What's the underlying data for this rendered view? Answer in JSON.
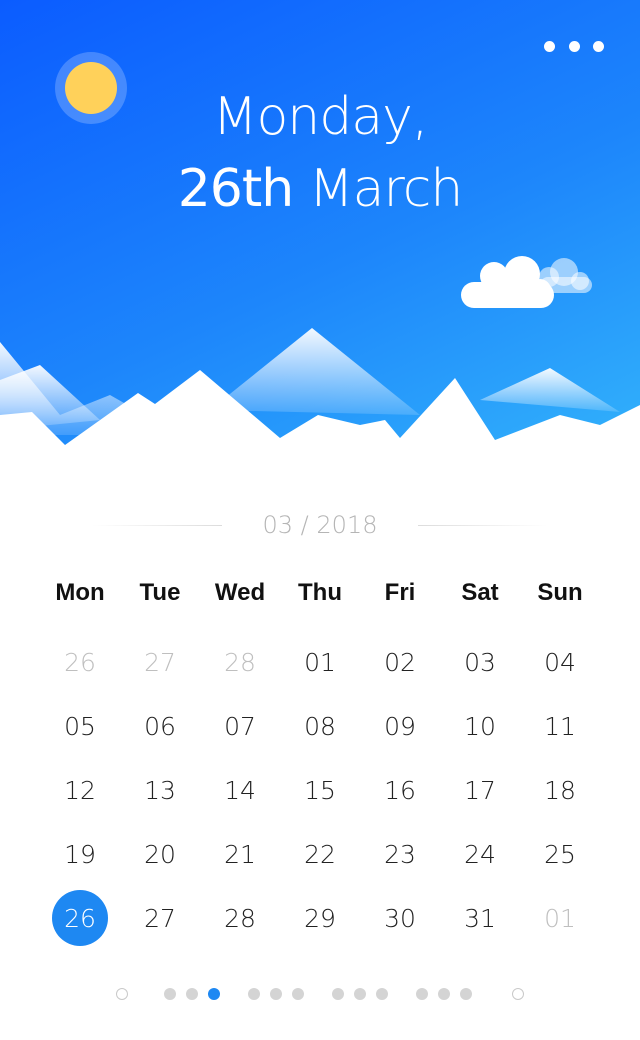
{
  "header": {
    "day_line": "Monday,",
    "date_number": "26th",
    "date_month": "March",
    "menu_icon": "more-dots-icon"
  },
  "calendar": {
    "month_label": "03 / 2018",
    "weekdays": [
      "Mon",
      "Tue",
      "Wed",
      "Thu",
      "Fri",
      "Sat",
      "Sun"
    ],
    "days": [
      {
        "label": "26",
        "muted": true
      },
      {
        "label": "27",
        "muted": true
      },
      {
        "label": "28",
        "muted": true
      },
      {
        "label": "01"
      },
      {
        "label": "02"
      },
      {
        "label": "03"
      },
      {
        "label": "04"
      },
      {
        "label": "05"
      },
      {
        "label": "06"
      },
      {
        "label": "07"
      },
      {
        "label": "08"
      },
      {
        "label": "09"
      },
      {
        "label": "10"
      },
      {
        "label": "11"
      },
      {
        "label": "12"
      },
      {
        "label": "13"
      },
      {
        "label": "14"
      },
      {
        "label": "15"
      },
      {
        "label": "16"
      },
      {
        "label": "17"
      },
      {
        "label": "18"
      },
      {
        "label": "19"
      },
      {
        "label": "20"
      },
      {
        "label": "21"
      },
      {
        "label": "22"
      },
      {
        "label": "23"
      },
      {
        "label": "24"
      },
      {
        "label": "25"
      },
      {
        "label": "26",
        "selected": true
      },
      {
        "label": "27"
      },
      {
        "label": "28"
      },
      {
        "label": "29"
      },
      {
        "label": "30"
      },
      {
        "label": "31"
      },
      {
        "label": "01",
        "muted": true
      }
    ]
  },
  "pager": {
    "dots": [
      {
        "style": "ring"
      },
      {
        "style": "dot"
      },
      {
        "style": "dot"
      },
      {
        "style": "active"
      },
      {
        "style": "dot"
      },
      {
        "style": "dot"
      },
      {
        "style": "dot"
      },
      {
        "style": "dot"
      },
      {
        "style": "dot"
      },
      {
        "style": "dot"
      },
      {
        "style": "dot"
      },
      {
        "style": "dot"
      },
      {
        "style": "dot"
      },
      {
        "style": "ring"
      }
    ]
  },
  "colors": {
    "accent": "#1e88f2",
    "sun": "#ffd15a",
    "sky_top": "#0b5cff",
    "sky_bottom": "#33b4fb"
  }
}
